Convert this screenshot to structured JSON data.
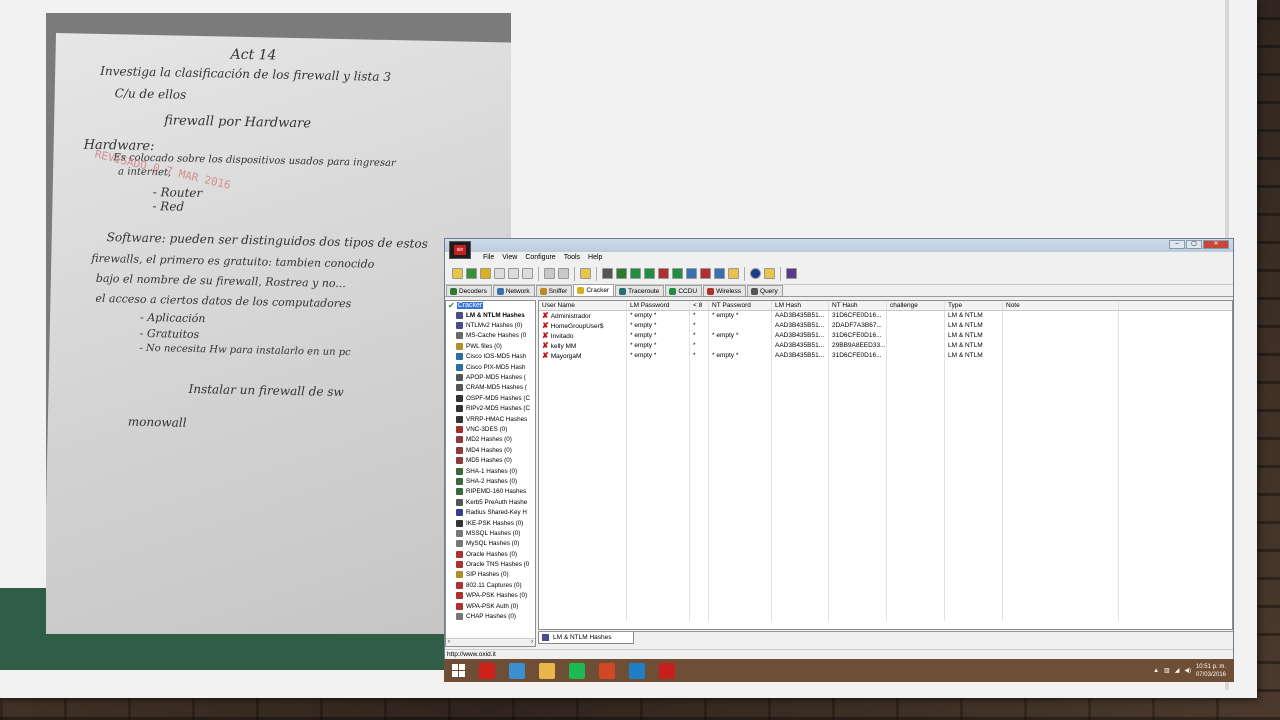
{
  "paper": {
    "lines": [
      "Act 14",
      "Investiga la clasificación de los firewall y lista 3",
      "C/u de ellos",
      "firewall por Hardware",
      "Hardware:",
      "Es colocado sobre los dispositivos usados para ingresar",
      "a internet,",
      "- Router",
      "- Red",
      "Software: pueden ser distinguidos dos tipos de estos",
      "firewalls, el primero es gratuito: tambien conocido",
      "bajo el nombre de su firewall, Rostrea y no...",
      "el acceso a ciertos datos de los computadores",
      "- Aplicación",
      "- Gratuitos",
      "- No necesita Hw para instalarlo en un pc",
      "Instalar un firewall de sw",
      "monowall"
    ],
    "stamp": "REVISADO 0 7 MAR 2016"
  },
  "window": {
    "menu": [
      "File",
      "View",
      "Configure",
      "Tools",
      "Help"
    ],
    "tabs": [
      {
        "label": "Decoders",
        "color": "#2f7a2f"
      },
      {
        "label": "Network",
        "color": "#3a6fb0"
      },
      {
        "label": "Sniffer",
        "color": "#c08a20"
      },
      {
        "label": "Cracker",
        "color": "#d4b020",
        "active": true
      },
      {
        "label": "Traceroute",
        "color": "#2a6f6f"
      },
      {
        "label": "CCDU",
        "color": "#1f8f3f"
      },
      {
        "label": "Wireless",
        "color": "#b03030"
      },
      {
        "label": "Query",
        "color": "#555555"
      }
    ],
    "tree_root": "Cracker",
    "tree": [
      {
        "label": "LM & NTLM Hashes",
        "bold": true,
        "color": "#4b4b8f"
      },
      {
        "label": "NTLMv2 Hashes (0)",
        "color": "#4b4b8f"
      },
      {
        "label": "MS-Cache Hashes (0",
        "color": "#6a6a6a"
      },
      {
        "label": "PWL files (0)",
        "color": "#b08f2a"
      },
      {
        "label": "Cisco IOS-MD5 Hash",
        "color": "#2a6f9f"
      },
      {
        "label": "Cisco PIX-MD5 Hash",
        "color": "#2a6f9f"
      },
      {
        "label": "APOP-MD5 Hashes (",
        "color": "#555555"
      },
      {
        "label": "CRAM-MD5 Hashes (",
        "color": "#555555"
      },
      {
        "label": "OSPF-MD5 Hashes (C",
        "color": "#333333"
      },
      {
        "label": "RIPv2-MD5 Hashes (C",
        "color": "#333333"
      },
      {
        "label": "VRRP-HMAC Hashes",
        "color": "#333333"
      },
      {
        "label": "VNC-3DES (0)",
        "color": "#a03030"
      },
      {
        "label": "MD2 Hashes (0)",
        "color": "#8f3a3a"
      },
      {
        "label": "MD4 Hashes (0)",
        "color": "#8f3a3a"
      },
      {
        "label": "MD5 Hashes (0)",
        "color": "#8f3a3a"
      },
      {
        "label": "SHA-1 Hashes (0)",
        "color": "#3a6a3a"
      },
      {
        "label": "SHA-2 Hashes (0)",
        "color": "#3a6a3a"
      },
      {
        "label": "RIPEMD-160 Hashes",
        "color": "#3a6a3a"
      },
      {
        "label": "Kerb5 PreAuth Hashe",
        "color": "#555555"
      },
      {
        "label": "Radius Shared-Key H",
        "color": "#3a3a8f"
      },
      {
        "label": "IKE-PSK Hashes (0)",
        "color": "#333333"
      },
      {
        "label": "MSSQL Hashes (0)",
        "color": "#777777"
      },
      {
        "label": "MySQL Hashes (0)",
        "color": "#777777"
      },
      {
        "label": "Oracle Hashes (0)",
        "color": "#b03030"
      },
      {
        "label": "Oracle TNS Hashes (0",
        "color": "#b03030"
      },
      {
        "label": "SIP Hashes (0)",
        "color": "#b08f2a"
      },
      {
        "label": "802.11 Captures (0)",
        "color": "#b03030"
      },
      {
        "label": "WPA-PSK Hashes (0)",
        "color": "#b03030"
      },
      {
        "label": "WPA-PSK Auth (0)",
        "color": "#b03030"
      },
      {
        "label": "CHAP Hashes (0)",
        "color": "#777777"
      }
    ],
    "columns": [
      "User Name",
      "LM Password",
      "< 8",
      "NT Password",
      "LM Hash",
      "NT Hash",
      "challenge",
      "Type",
      "Note"
    ],
    "rows": [
      {
        "user": "Administrador",
        "lm_pw": "* empty *",
        "lt8": "*",
        "nt_pw": "* empty *",
        "lm_hash": "AAD3B435B51...",
        "nt_hash": "31D6CFE0D16...",
        "challenge": "",
        "type": "LM & NTLM",
        "note": ""
      },
      {
        "user": "HomeGroupUser$",
        "lm_pw": "* empty *",
        "lt8": "*",
        "nt_pw": "",
        "lm_hash": "AAD3B435B51...",
        "nt_hash": "2DADF7A3B67...",
        "challenge": "",
        "type": "LM & NTLM",
        "note": ""
      },
      {
        "user": "Invitado",
        "lm_pw": "* empty *",
        "lt8": "*",
        "nt_pw": "* empty *",
        "lm_hash": "AAD3B435B51...",
        "nt_hash": "31D6CFE0D16...",
        "challenge": "",
        "type": "LM & NTLM",
        "note": ""
      },
      {
        "user": "kelly MM",
        "lm_pw": "* empty *",
        "lt8": "*",
        "nt_pw": "",
        "lm_hash": "AAD3B435B51...",
        "nt_hash": "29BB9A8EED33...",
        "challenge": "",
        "type": "LM & NTLM",
        "note": ""
      },
      {
        "user": "MayorgaM",
        "lm_pw": "* empty *",
        "lt8": "*",
        "nt_pw": "* empty *",
        "lm_hash": "AAD3B435B51...",
        "nt_hash": "31D6CFE0D16...",
        "challenge": "",
        "type": "LM & NTLM",
        "note": ""
      }
    ],
    "bottom_tab": "LM & NTLM Hashes",
    "status": "http://www.oxid.it"
  },
  "taskbar": {
    "apps": [
      {
        "name": "opera-icon",
        "color": "#d0201a"
      },
      {
        "name": "notepad-icon",
        "color": "#3a8fd0"
      },
      {
        "name": "file-explorer-icon",
        "color": "#e8b64a"
      },
      {
        "name": "spotify-icon",
        "color": "#1db954"
      },
      {
        "name": "powerpoint-icon",
        "color": "#d24726"
      },
      {
        "name": "photos-icon",
        "color": "#1e7fc4"
      },
      {
        "name": "cain-icon",
        "color": "#c81e1e"
      }
    ],
    "time": "10:51 p. m.",
    "date": "07/03/2016"
  }
}
